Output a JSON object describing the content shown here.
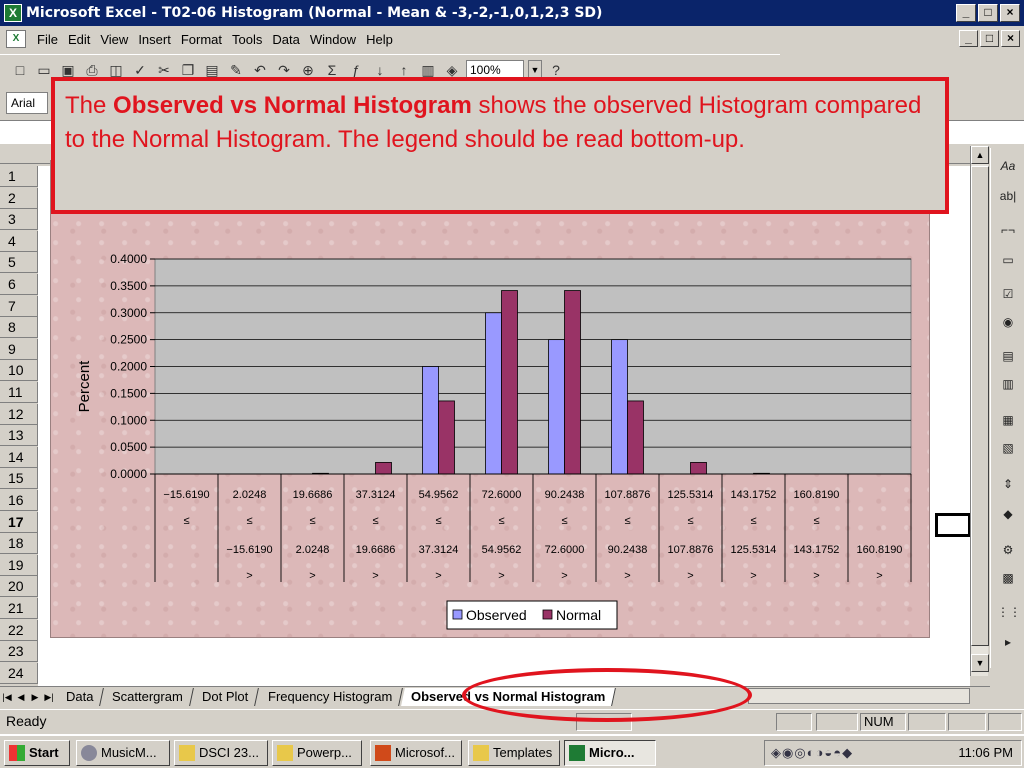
{
  "window": {
    "title": "Microsoft Excel - T02-06 Histogram (Normal - Mean & -3,-2,-1,0,1,2,3 SD)",
    "min": "_",
    "max": "□",
    "close": "×"
  },
  "menu": [
    "File",
    "Edit",
    "View",
    "Insert",
    "Format",
    "Tools",
    "Data",
    "Window",
    "Help"
  ],
  "toolbar": {
    "zoom": "100%"
  },
  "font_box": "Arial",
  "rows": [
    "1",
    "2",
    "3",
    "4",
    "5",
    "6",
    "7",
    "8",
    "9",
    "10",
    "11",
    "12",
    "13",
    "14",
    "15",
    "16",
    "17",
    "18",
    "19",
    "20",
    "21",
    "22",
    "23",
    "24"
  ],
  "active_row": "17",
  "callout": {
    "pre": "The ",
    "bold": "Observed vs Normal Histogram",
    "post": " shows the observed Histogram compared to the Normal Histogram.  The legend should be read bottom-up."
  },
  "chart_data": {
    "type": "bar",
    "ylabel": "Percent",
    "ylim": [
      0,
      0.4
    ],
    "yticks": [
      "0.4000",
      "0.3500",
      "0.3000",
      "0.2500",
      "0.2000",
      "0.1500",
      "0.1000",
      "0.0500",
      "0.0000"
    ],
    "categories": [
      [
        "−15.6190",
        "≤",
        "",
        ""
      ],
      [
        "2.0248",
        "≤",
        "−15.6190",
        ">"
      ],
      [
        "19.6686",
        "≤",
        "2.0248",
        ">"
      ],
      [
        "37.3124",
        "≤",
        "19.6686",
        ">"
      ],
      [
        "54.9562",
        "≤",
        "37.3124",
        ">"
      ],
      [
        "72.6000",
        "≤",
        "54.9562",
        ">"
      ],
      [
        "90.2438",
        "≤",
        "72.6000",
        ">"
      ],
      [
        "107.8876",
        "≤",
        "90.2438",
        ">"
      ],
      [
        "125.5314",
        "≤",
        "107.8876",
        ">"
      ],
      [
        "143.1752",
        "≤",
        "125.5314",
        ">"
      ],
      [
        "160.8190",
        "≤",
        "143.1752",
        ">"
      ],
      [
        "",
        "",
        "160.8190",
        ">"
      ]
    ],
    "series": [
      {
        "name": "Observed",
        "color": "#9999ff",
        "values": [
          0,
          0,
          0,
          0,
          0.2,
          0.3,
          0.25,
          0.25,
          0,
          0,
          0,
          0
        ]
      },
      {
        "name": "Normal",
        "color": "#993366",
        "values": [
          0,
          0,
          0.0013,
          0.0215,
          0.1359,
          0.3413,
          0.3413,
          0.1359,
          0.0215,
          0.0013,
          0,
          0
        ]
      }
    ],
    "legend": "bottom"
  },
  "tabs": [
    "Data",
    "Scattergram",
    "Dot Plot",
    "Frequency Histogram",
    "Observed vs Normal Histogram"
  ],
  "active_tab": "Observed vs Normal Histogram",
  "status": {
    "ready": "Ready",
    "num": "NUM"
  },
  "taskbar": {
    "start": "Start",
    "items": [
      "MusicM...",
      "DSCI 23...",
      "Powerp...",
      "Microsof...",
      "Templates",
      "Micro..."
    ],
    "clock": "11:06 PM"
  }
}
